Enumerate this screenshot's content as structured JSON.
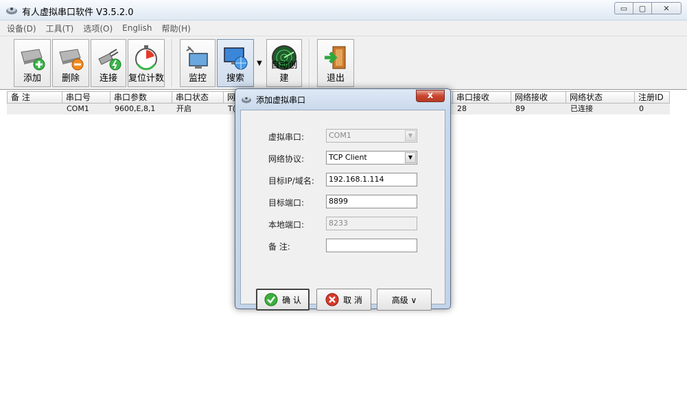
{
  "window": {
    "title": "有人虚拟串口软件 V3.5.2.0",
    "minimize": "▭",
    "maximize": "▢",
    "close": "✕"
  },
  "menu": [
    "设备(D)",
    "工具(T)",
    "选项(O)",
    "English",
    "帮助(H)"
  ],
  "toolbar": {
    "add": "添加",
    "delete": "删除",
    "connect": "连接",
    "reset_count": "复位计数",
    "monitor": "监控",
    "search": "搜索",
    "search_dropdown": "▼",
    "auto_create": "自动创建",
    "exit": "退出"
  },
  "table": {
    "columns": [
      "备 注",
      "串口号",
      "串口参数",
      "串口状态",
      "网",
      "串口接收",
      "网络接收",
      "网络状态",
      "注册ID"
    ],
    "rows": [
      [
        "",
        "COM1",
        "9600,E,8,1",
        "开启",
        "T(",
        "28",
        "89",
        "已连接",
        "0"
      ]
    ]
  },
  "dialog": {
    "title": "添加虚拟串口",
    "close": "x",
    "labels": {
      "virtual_port": "虚拟串口:",
      "protocol": "网络协议:",
      "target_ip": "目标IP/域名:",
      "target_port": "目标端口:",
      "local_port": "本地端口:",
      "remark": "备  注:"
    },
    "values": {
      "virtual_port": "COM1",
      "protocol": "TCP Client",
      "target_ip": "192.168.1.114",
      "target_port": "8899",
      "local_port": "8233",
      "remark": ""
    },
    "select_arrow": "▼",
    "buttons": {
      "ok": "确 认",
      "cancel": "取 消",
      "advanced": "高级 ∨"
    }
  }
}
